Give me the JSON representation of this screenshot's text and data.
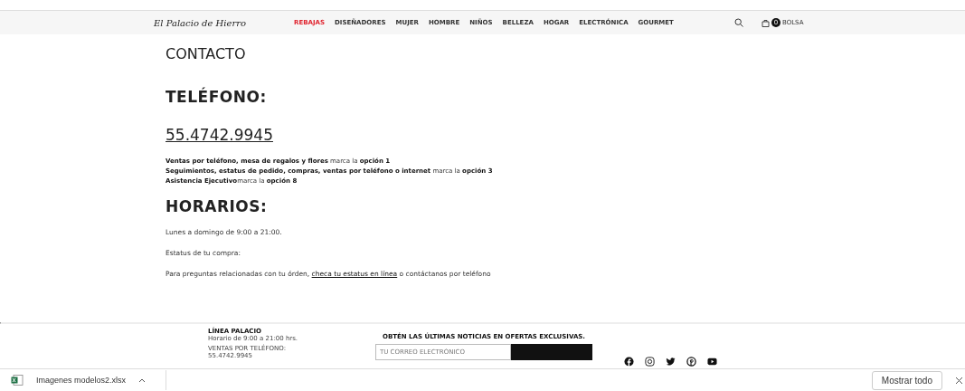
{
  "header": {
    "logo": "El Palacio de Hierro",
    "nav": [
      {
        "label": "REBAJAS",
        "selected": true
      },
      {
        "label": "DISEÑADORES",
        "selected": false
      },
      {
        "label": "MUJER",
        "selected": false
      },
      {
        "label": "HOMBRE",
        "selected": false
      },
      {
        "label": "NIÑOS",
        "selected": false
      },
      {
        "label": "BELLEZA",
        "selected": false
      },
      {
        "label": "HOGAR",
        "selected": false
      },
      {
        "label": "ELECTRÓNICA",
        "selected": false
      },
      {
        "label": "GOURMET",
        "selected": false
      }
    ],
    "bag_count": "0",
    "bag_label": "BOLSA"
  },
  "content": {
    "title": "CONTACTO",
    "phone_heading": "TELÉFONO:",
    "phone": "55.4742.9945",
    "options": [
      "**Ventas por teléfono, mesa de regalos y flores** marca la **opción 1**",
      "**Seguimientos, estatus de pedido, compras, ventas por teléfono o internet** marca la **opción 3**",
      "**Asistencia Ejecutivo**marca la **opción 8**"
    ],
    "hours_heading": "HORARIOS:",
    "hours": "Lunes a domingo de 9:00 a 21:00.",
    "status_label": "Estatus de tu compra:",
    "help": {
      "before": "Para preguntas relacionadas con tu órden, ",
      "link": "checa tu estatus en línea",
      "after": " o contáctanos por teléfono"
    }
  },
  "footer": {
    "line_title": "LÍNEA PALACIO",
    "line_hours": "Horario de 9:00 a 21:00 hrs.",
    "sales_label": "VENTAS POR TELÉFONO:",
    "sales_phone": "55.4742.9945",
    "newsletter": "OBTÉN LAS ÚLTIMAS NOTICIAS EN OFERTAS EXCLUSIVAS.",
    "email_placeholder": "TU CORREO ELECTRÓNICO"
  },
  "downloads": {
    "file": "Imagenes modelos2.xlsx",
    "show_all": "Mostrar todo"
  }
}
